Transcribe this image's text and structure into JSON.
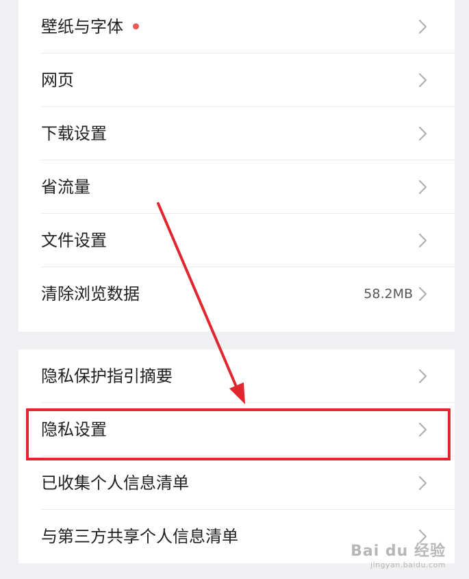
{
  "colors": {
    "page_background": "#f0f0f2",
    "card_background": "#ffffff",
    "text_primary": "#1f1f1f",
    "text_secondary": "#555555",
    "chevron": "#b0b0b0",
    "badge_dot": "#e8595a",
    "annotation_red": "#e0262e"
  },
  "settings_group_1": {
    "items": [
      {
        "label": "壁纸与字体",
        "badge": true,
        "icon": "chevron-right-icon"
      },
      {
        "label": "网页",
        "icon": "chevron-right-icon"
      },
      {
        "label": "下载设置",
        "icon": "chevron-right-icon"
      },
      {
        "label": "省流量",
        "icon": "chevron-right-icon"
      },
      {
        "label": "文件设置",
        "icon": "chevron-right-icon"
      },
      {
        "label": "清除浏览数据",
        "value": "58.2MB",
        "icon": "chevron-right-icon"
      }
    ]
  },
  "settings_group_2": {
    "items": [
      {
        "label": "隐私保护指引摘要",
        "icon": "chevron-right-icon"
      },
      {
        "label": "隐私设置",
        "icon": "chevron-right-icon",
        "highlighted": true
      },
      {
        "label": "已收集个人信息清单",
        "icon": "chevron-right-icon"
      },
      {
        "label": "与第三方共享个人信息清单",
        "icon": "chevron-right-icon"
      }
    ]
  },
  "annotation": {
    "type": "arrow-and-box",
    "target": "隐私设置"
  },
  "watermark": {
    "text": "Bai du 经验",
    "url": "jingyan.baidu.com"
  }
}
